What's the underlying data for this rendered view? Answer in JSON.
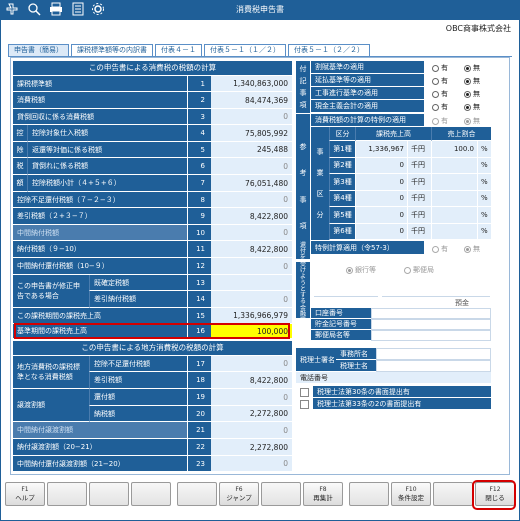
{
  "window": {
    "title": "消費税申告書",
    "company": "OBC商事株式会社"
  },
  "toolbar_icons": [
    "add-icon",
    "search-icon",
    "print-icon",
    "list-icon",
    "gear-icon"
  ],
  "tabs": [
    {
      "label": "申告書（簡易）"
    },
    {
      "label": "課税標準額等の内訳書"
    },
    {
      "label": "付表４－１"
    },
    {
      "label": "付表５－１（１／２）"
    },
    {
      "label": "付表５－１（２／２）"
    }
  ],
  "national": {
    "header": "この申告書による消費税の税額の計算",
    "rows": [
      {
        "label": "課税標準額",
        "no": "1",
        "value": "1,340,863,000"
      },
      {
        "label": "消費税額",
        "no": "2",
        "value": "84,474,369"
      },
      {
        "label": "貸倒回収に係る消費税額",
        "no": "3",
        "value": "0"
      },
      {
        "label": "控除対象仕入税額",
        "no": "4",
        "value": "75,805,992"
      },
      {
        "label": "返還等対価に係る税額",
        "no": "5",
        "value": "245,488"
      },
      {
        "label": "貸倒れに係る税額",
        "no": "6",
        "value": "0"
      },
      {
        "label": "控除税額小計（４+５+６）",
        "no": "7",
        "value": "76,051,480"
      },
      {
        "label": "控除不足還付税額（７−２−３）",
        "no": "8",
        "value": "0"
      },
      {
        "label": "差引税額（２+３−７）",
        "no": "9",
        "value": "8,422,800"
      },
      {
        "label": "中間納付税額",
        "no": "10",
        "value": "0"
      },
      {
        "label": "納付税額（９−10）",
        "no": "11",
        "value": "8,422,800"
      },
      {
        "label": "中間納付還付税額（10−９）",
        "no": "12",
        "value": "0"
      },
      {
        "label": "既確定税額",
        "no": "13",
        "value": ""
      },
      {
        "label": "差引納付税額",
        "no": "14",
        "value": "0"
      },
      {
        "label": "この課税期間の課税売上高",
        "no": "15",
        "value": "1,336,966,979"
      },
      {
        "label": "基準期間の課税売上高",
        "no": "16",
        "value": "100,000"
      }
    ],
    "vertical_labels": [
      "控",
      "除",
      "税",
      "額"
    ],
    "amend_label": "この申告書が修正申告である場合"
  },
  "local": {
    "header": "この申告書による地方消費税の税額の計算",
    "group_label": "地方消費税の課税標準となる消費税額",
    "transfer_label": "譲渡割額",
    "rows": [
      {
        "label": "控除不足還付税額",
        "no": "17",
        "value": "0"
      },
      {
        "label": "差引税額",
        "no": "18",
        "value": "8,422,800"
      },
      {
        "label": "還付額",
        "no": "19",
        "value": "0"
      },
      {
        "label": "納税額",
        "no": "20",
        "value": "2,272,800"
      },
      {
        "label": "中間納付譲渡割額",
        "no": "21",
        "value": "0"
      },
      {
        "label": "納付譲渡割額（20−21）",
        "no": "22",
        "value": "2,272,800"
      },
      {
        "label": "中間納付還付譲渡割額（21−20）",
        "no": "23",
        "value": "0"
      }
    ]
  },
  "appendix": {
    "side_label": [
      "付",
      "記",
      "事",
      "項"
    ],
    "items": [
      {
        "label": "割賦基準の適用",
        "yes": "有",
        "no": "無"
      },
      {
        "label": "延払基準等の適用",
        "yes": "有",
        "no": "無"
      },
      {
        "label": "工事進行基準の適用",
        "yes": "有",
        "no": "無"
      },
      {
        "label": "現金主義会計の適用",
        "yes": "有",
        "no": "無"
      }
    ]
  },
  "reference": {
    "side_label": [
      "参",
      "考",
      "事",
      "項"
    ],
    "special_label": "消費税額の計算の特例の適用",
    "special_yes": "有",
    "special_no": "無",
    "biz_label": [
      "事",
      "業",
      "区",
      "分"
    ],
    "col_kubun": "区分",
    "col_sales": "課税売上高",
    "col_ratio": "売上割合",
    "yen": "千円",
    "pct": "%",
    "rows": [
      {
        "kubun": "第1種",
        "sales": "1,336,967",
        "ratio": "100.0"
      },
      {
        "kubun": "第2種",
        "sales": "0",
        "ratio": ""
      },
      {
        "kubun": "第3種",
        "sales": "0",
        "ratio": ""
      },
      {
        "kubun": "第4種",
        "sales": "0",
        "ratio": ""
      },
      {
        "kubun": "第5種",
        "sales": "0",
        "ratio": ""
      },
      {
        "kubun": "第6種",
        "sales": "0",
        "ratio": ""
      }
    ],
    "exception_label": "特例計算適用（令57-3）",
    "exception_yes": "有",
    "exception_no": "無"
  },
  "refund": {
    "side_label": [
      "還",
      "付",
      "を",
      "受",
      "け",
      "よ",
      "う",
      "と",
      "す",
      "る",
      "金",
      "融",
      "機",
      "関",
      "等"
    ],
    "bank_option": "銀行等",
    "post_option": "郵便局",
    "deposit": "預金",
    "account_label": "口座番号",
    "savings_label": "貯金記号番号",
    "post_name_label": "郵便局名等"
  },
  "tax_accountant": {
    "label": "税理士署名",
    "office_label": "事務所名",
    "name_label": "税理士名",
    "phone_label": "電話番号"
  },
  "checks": [
    {
      "label": "税理士法第30条の書面提出有"
    },
    {
      "label": "税理士法第33条の2の書面提出有"
    }
  ],
  "fkeys": [
    {
      "key": "F1",
      "label": "ヘルプ"
    },
    {
      "key": "",
      "label": ""
    },
    {
      "key": "",
      "label": ""
    },
    {
      "key": "",
      "label": ""
    },
    {
      "key": "",
      "label": ""
    },
    {
      "key": "F6",
      "label": "ジャンプ"
    },
    {
      "key": "",
      "label": ""
    },
    {
      "key": "F8",
      "label": "再集計"
    },
    {
      "key": "",
      "label": ""
    },
    {
      "key": "F10",
      "label": "条件設定"
    },
    {
      "key": "",
      "label": ""
    },
    {
      "key": "F12",
      "label": "閉じる"
    }
  ]
}
